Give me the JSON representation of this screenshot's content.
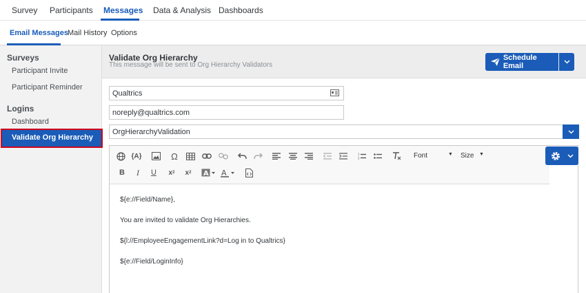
{
  "topnav": {
    "tabs": [
      {
        "label": "Survey",
        "active": false
      },
      {
        "label": "Participants",
        "active": false
      },
      {
        "label": "Messages",
        "active": true
      },
      {
        "label": "Data & Analysis",
        "active": false
      },
      {
        "label": "Dashboards",
        "active": false
      }
    ]
  },
  "subnav": {
    "tabs": [
      {
        "label": "Email Messages",
        "active": true
      },
      {
        "label": "Mail History",
        "active": false
      },
      {
        "label": "Options",
        "active": false
      }
    ]
  },
  "sidebar": {
    "sections": [
      {
        "label": "Surveys",
        "items": [
          "Participant Invite",
          "Participant Reminder"
        ]
      },
      {
        "label": "Logins",
        "items": [
          "Dashboard",
          "Validate Org Hierarchy"
        ]
      }
    ],
    "selected": "Validate Org Hierarchy"
  },
  "header": {
    "title": "Validate Org Hierarchy",
    "subtitle": "This message will be sent to Org Hierarchy Validators",
    "schedule_label": "Schedule Email"
  },
  "fields": {
    "from_name": "Qualtrics",
    "from_email": "noreply@qualtrics.com",
    "subject": "OrgHierarchyValidation"
  },
  "toolbar": {
    "font_label": "Font",
    "size_label": "Size"
  },
  "body": {
    "lines": [
      "${e://Field/Name},",
      "You are invited to validate Org Hierarchies.",
      "${l://EmployeeEngagementLink?d=Log in to Qualtrics}",
      "${e://Field/LoginInfo}"
    ]
  },
  "colors": {
    "accent": "#1a5cb8",
    "highlight_outline": "#d0021b"
  }
}
